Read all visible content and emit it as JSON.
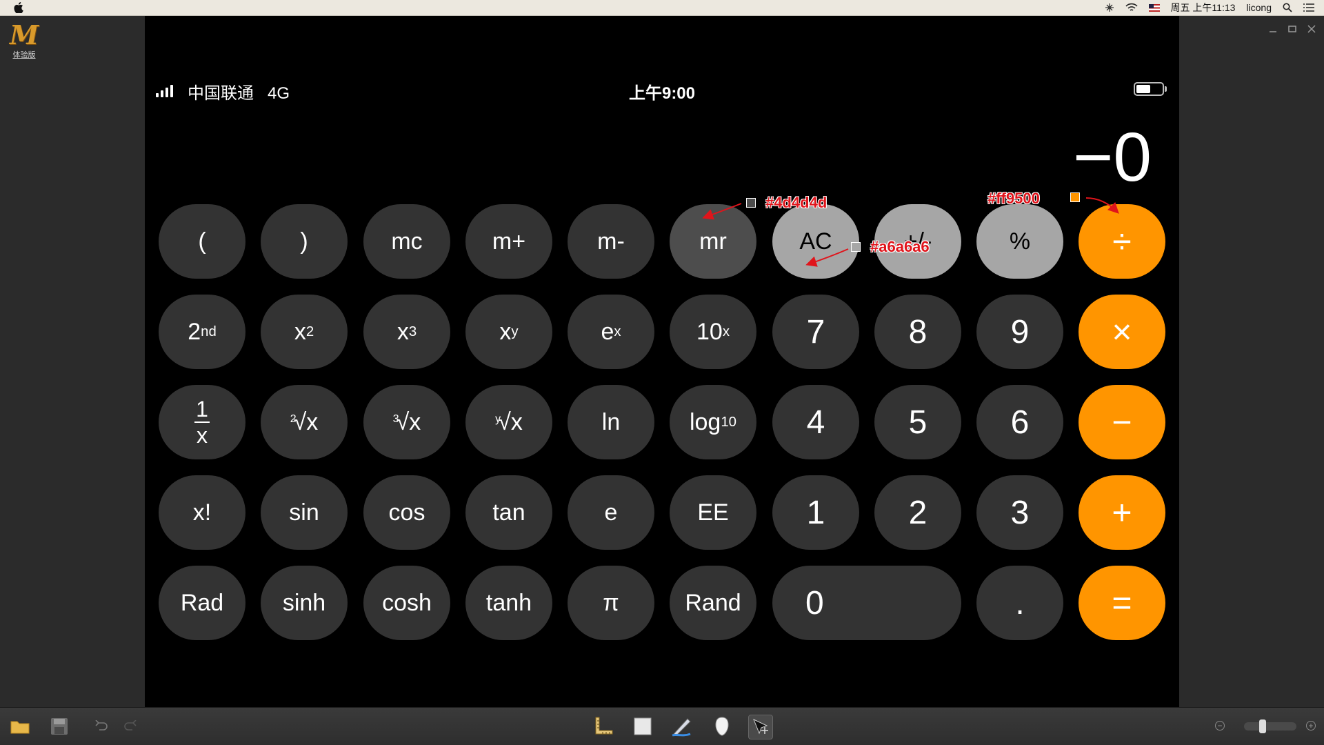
{
  "menubar": {
    "apple_icon": "apple-logo",
    "datetime": "周五 上午11:13",
    "user": "licong"
  },
  "app": {
    "logo_text": "M",
    "logo_sub": "体验版"
  },
  "phone_status": {
    "carrier": "中国联通",
    "network": "4G",
    "time": "上午9:00",
    "battery_level": 0.55
  },
  "display": {
    "value": "−0"
  },
  "colors": {
    "mid_gray": "#4d4d4d",
    "light_gray": "#a6a6a6",
    "orange": "#ff9500",
    "dark_gray": "#333333"
  },
  "annotations": [
    {
      "text": "#4d4d4d",
      "swatch": "#4d4d4d"
    },
    {
      "text": "#a6a6a6",
      "swatch": "#a6a6a6"
    },
    {
      "text": "#ff9500",
      "swatch": "#ff9500"
    }
  ],
  "keys": {
    "open_paren": "(",
    "close_paren": ")",
    "mc": "mc",
    "m_plus": "m+",
    "m_minus": "m-",
    "mr": "mr",
    "ac": "AC",
    "plus_minus": "+/-",
    "percent": "%",
    "divide": "÷",
    "second_base": "2",
    "second_sup": "nd",
    "x2_base": "x",
    "x2_sup": "2",
    "x3_base": "x",
    "x3_sup": "3",
    "xy_base": "x",
    "xy_sup": "y",
    "ex_base": "e",
    "ex_sup": "x",
    "tenx_base": "10",
    "tenx_sup": "x",
    "seven": "7",
    "eight": "8",
    "nine": "9",
    "multiply": "×",
    "recip_num": "1",
    "recip_den": "x",
    "sqrt2_idx": "2",
    "sqrt2_body": "√x",
    "sqrt3_idx": "3",
    "sqrt3_body": "√x",
    "sqrty_idx": "y",
    "sqrty_body": "√x",
    "ln": "ln",
    "log_base": "log",
    "log_sub": "10",
    "four": "4",
    "five": "5",
    "six": "6",
    "minus": "−",
    "factorial": "x!",
    "sin": "sin",
    "cos": "cos",
    "tan": "tan",
    "e": "e",
    "ee": "EE",
    "one": "1",
    "two": "2",
    "three": "3",
    "plus": "+",
    "rad": "Rad",
    "sinh": "sinh",
    "cosh": "cosh",
    "tanh": "tanh",
    "pi": "π",
    "rand": "Rand",
    "zero": "0",
    "dot": ".",
    "equals": "="
  }
}
